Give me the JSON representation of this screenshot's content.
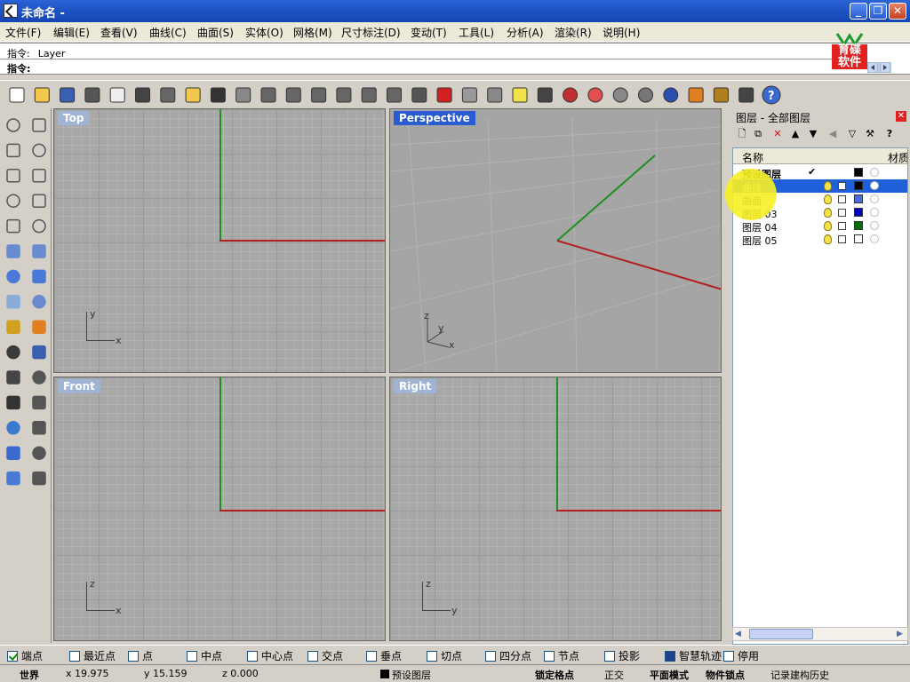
{
  "window": {
    "title": "未命名 -",
    "buttons": [
      "minimize",
      "maximize",
      "close"
    ]
  },
  "menu": [
    "文件(F)",
    "编辑(E)",
    "查看(V)",
    "曲线(C)",
    "曲面(S)",
    "实体(O)",
    "网格(M)",
    "尺寸标注(D)",
    "变动(T)",
    "工具(L)",
    "分析(A)",
    "渲染(R)",
    "说明(H)"
  ],
  "command": {
    "history_line": "指令: _Layer",
    "prompt_label": "指令:"
  },
  "logo": {
    "text_line1": "育碟",
    "text_line2": "软件"
  },
  "toolbar_icons": [
    "new-icon",
    "open-icon",
    "save-icon",
    "print-icon",
    "import-icon",
    "cut-icon",
    "copy-icon",
    "paste-icon",
    "undo-icon",
    "pan-icon",
    "rotate-view-icon",
    "zoom-dynamic-icon",
    "zoom-window-icon",
    "zoom-extents-icon",
    "zoom-selected-icon",
    "undo-view-icon",
    "four-viewports-icon",
    "car-icon",
    "construction-plane-icon",
    "object-snap-icon",
    "light-icon",
    "lock-icon",
    "layer-icon",
    "color-wheel-icon",
    "wireframe-sphere-icon",
    "grid-sphere-icon",
    "render-sphere-icon",
    "edit-icon",
    "options-icon",
    "properties-icon",
    "help-icon"
  ],
  "viewports": [
    {
      "label": "Top",
      "active": false,
      "axis1": "y",
      "axis2": "x"
    },
    {
      "label": "Perspective",
      "active": true,
      "axis1": "z",
      "axis2": "y",
      "axis3": "x"
    },
    {
      "label": "Front",
      "active": false,
      "axis1": "z",
      "axis2": "x"
    },
    {
      "label": "Right",
      "active": false,
      "axis1": "z",
      "axis2": "y"
    }
  ],
  "layers_panel": {
    "title": "图层 - 全部图层",
    "columns": {
      "name": "名称",
      "material": "材质"
    },
    "rows": [
      {
        "name": "预设图层",
        "current": true,
        "color": "#000000",
        "selected": false
      },
      {
        "name": "曲线",
        "current": false,
        "color": "#000000",
        "selected": true
      },
      {
        "name": "曲面",
        "current": false,
        "color": "#4a6fd8",
        "selected": false
      },
      {
        "name": "图层 03",
        "current": false,
        "color": "#0000c0",
        "selected": false
      },
      {
        "name": "图层 04",
        "current": false,
        "color": "#007000",
        "selected": false
      },
      {
        "name": "图层 05",
        "current": false,
        "color": "#ffffff",
        "selected": false
      }
    ]
  },
  "osnaps": [
    {
      "label": "端点",
      "checked": true
    },
    {
      "label": "最近点",
      "checked": false
    },
    {
      "label": "点",
      "checked": false
    },
    {
      "label": "中点",
      "checked": false
    },
    {
      "label": "中心点",
      "checked": false
    },
    {
      "label": "交点",
      "checked": false
    },
    {
      "label": "垂点",
      "checked": false
    },
    {
      "label": "切点",
      "checked": false
    },
    {
      "label": "四分点",
      "checked": false
    },
    {
      "label": "节点",
      "checked": false
    },
    {
      "label": "投影",
      "checked": false
    },
    {
      "label": "智慧轨迹",
      "checked": true
    },
    {
      "label": "停用",
      "checked": false
    }
  ],
  "status": {
    "cplane": "世界",
    "x": "x 19.975",
    "y": "y 15.159",
    "z": "z 0.000",
    "current_layer": "预设图层",
    "grid_snap": "锁定格点",
    "ortho": "正交",
    "planar": "平面模式",
    "osnap": "物件锁点",
    "history": "记录建构历史"
  },
  "colors": {
    "title_bar": "#2a64d6",
    "viewport_bg": "#a8a8a8",
    "active_label": "#2a5bd0",
    "selection": "#1f5fd8"
  }
}
